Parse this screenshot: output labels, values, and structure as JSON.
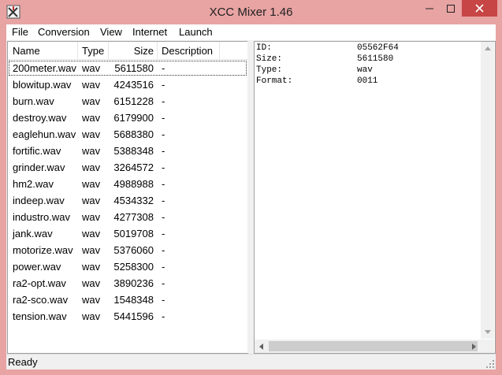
{
  "window": {
    "title": "XCC Mixer 1.46",
    "accent": "#e8a3a3",
    "close_color": "#c74545"
  },
  "menu": [
    {
      "id": "file",
      "label": "File"
    },
    {
      "id": "conversion",
      "label": "Conversion"
    },
    {
      "id": "view",
      "label": "View"
    },
    {
      "id": "internet",
      "label": "Internet"
    },
    {
      "id": "launch",
      "label": "Launch"
    }
  ],
  "list": {
    "columns": {
      "name": "Name",
      "type": "Type",
      "size": "Size",
      "description": "Description"
    },
    "rows": [
      {
        "name": "200meter.wav",
        "type": "wav",
        "size": "5611580",
        "desc": "-"
      },
      {
        "name": "blowitup.wav",
        "type": "wav",
        "size": "4243516",
        "desc": "-"
      },
      {
        "name": "burn.wav",
        "type": "wav",
        "size": "6151228",
        "desc": "-"
      },
      {
        "name": "destroy.wav",
        "type": "wav",
        "size": "6179900",
        "desc": "-"
      },
      {
        "name": "eaglehun.wav",
        "type": "wav",
        "size": "5688380",
        "desc": "-"
      },
      {
        "name": "fortific.wav",
        "type": "wav",
        "size": "5388348",
        "desc": "-"
      },
      {
        "name": "grinder.wav",
        "type": "wav",
        "size": "3264572",
        "desc": "-"
      },
      {
        "name": "hm2.wav",
        "type": "wav",
        "size": "4988988",
        "desc": "-"
      },
      {
        "name": "indeep.wav",
        "type": "wav",
        "size": "4534332",
        "desc": "-"
      },
      {
        "name": "industro.wav",
        "type": "wav",
        "size": "4277308",
        "desc": "-"
      },
      {
        "name": "jank.wav",
        "type": "wav",
        "size": "5019708",
        "desc": "-"
      },
      {
        "name": "motorize.wav",
        "type": "wav",
        "size": "5376060",
        "desc": "-"
      },
      {
        "name": "power.wav",
        "type": "wav",
        "size": "5258300",
        "desc": "-"
      },
      {
        "name": "ra2-opt.wav",
        "type": "wav",
        "size": "3890236",
        "desc": "-"
      },
      {
        "name": "ra2-sco.wav",
        "type": "wav",
        "size": "1548348",
        "desc": "-"
      },
      {
        "name": "tension.wav",
        "type": "wav",
        "size": "5441596",
        "desc": "-"
      }
    ]
  },
  "info": [
    {
      "key": "ID:",
      "value": "05562F64"
    },
    {
      "key": "Size:",
      "value": "5611580"
    },
    {
      "key": "Type:",
      "value": "wav"
    },
    {
      "key": "Format:",
      "value": "0011"
    }
  ],
  "status": {
    "text": "Ready"
  }
}
